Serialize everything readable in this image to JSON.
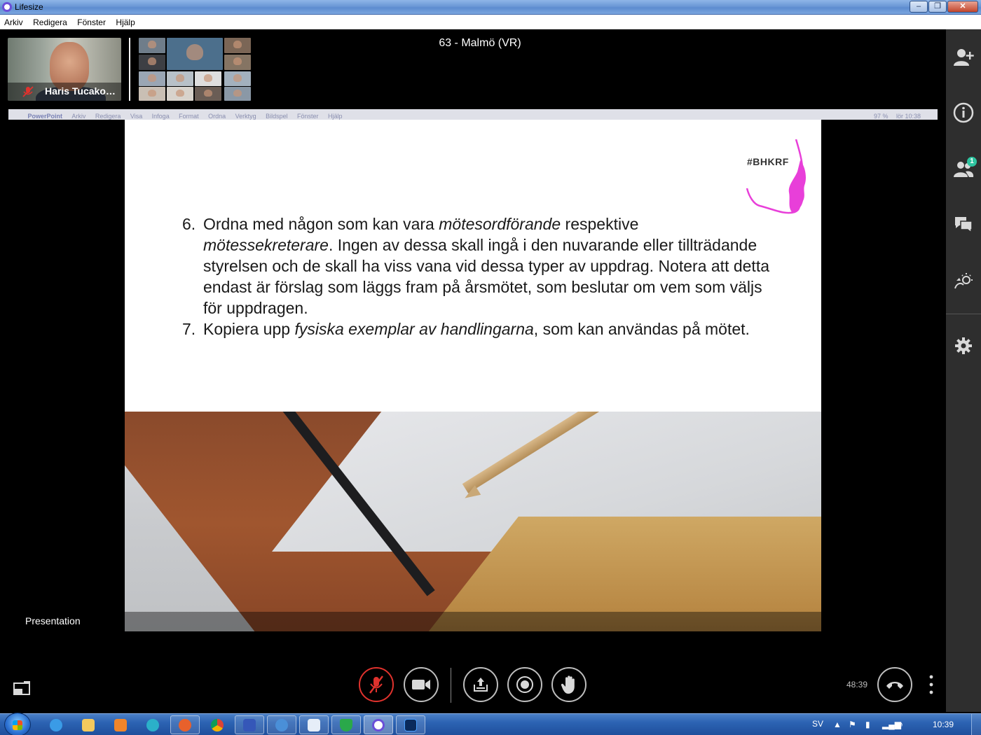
{
  "window": {
    "title": "Lifesize",
    "buttons": {
      "minimize": "–",
      "maximize": "❐",
      "close": "✕"
    }
  },
  "menubar": [
    "Arkiv",
    "Redigera",
    "Fönster",
    "Hjälp"
  ],
  "self_view": {
    "name": "Haris Tucako…",
    "muted": true
  },
  "meeting": {
    "name": "63 - Malmö (VR)"
  },
  "shared_screen": {
    "mac_menu": [
      "PowerPoint",
      "Arkiv",
      "Redigera",
      "Visa",
      "Infoga",
      "Format",
      "Ordna",
      "Verktyg",
      "Bildspel",
      "Fönster",
      "Hjälp"
    ],
    "mac_status": {
      "battery": "97 %",
      "clock": "lör 10:38"
    }
  },
  "slide": {
    "logo_text": "#BHKRF",
    "item6": {
      "num": "6.",
      "t1": "Ordna med någon som kan vara ",
      "i1": "mötesordförande",
      "t2": " respektive ",
      "i2": "mötessekreterare",
      "t3": ". Ingen av dessa skall ingå i den nuvarande eller tillträdande styrelsen och de skall ha viss vana vid dessa typer av uppdrag. Notera att detta endast är förslag som läggs fram på årsmötet, som beslutar om vem som väljs för uppdragen."
    },
    "item7": {
      "num": "7.",
      "t1": "Kopiera upp ",
      "i1": "fysiska exemplar av handlingarna",
      "t2": ", som kan användas på mötet."
    }
  },
  "presentation_label": "Presentation",
  "sidebar": {
    "icons": [
      "add-participant-icon",
      "info-icon",
      "participants-icon",
      "chat-icon",
      "effects-icon",
      "settings-icon"
    ],
    "participants_badge": "1"
  },
  "controls": {
    "buttons": [
      "mic-muted",
      "camera",
      "share",
      "record",
      "raise-hand"
    ],
    "timer": "48:39"
  },
  "taskbar": {
    "language": "SV",
    "clock": "10:39"
  },
  "colors": {
    "mute_red": "#e0322d",
    "badge_green": "#2ec4a0",
    "logo_magenta": "#e83fd9",
    "sidebar_bg": "#2e2e2e"
  }
}
